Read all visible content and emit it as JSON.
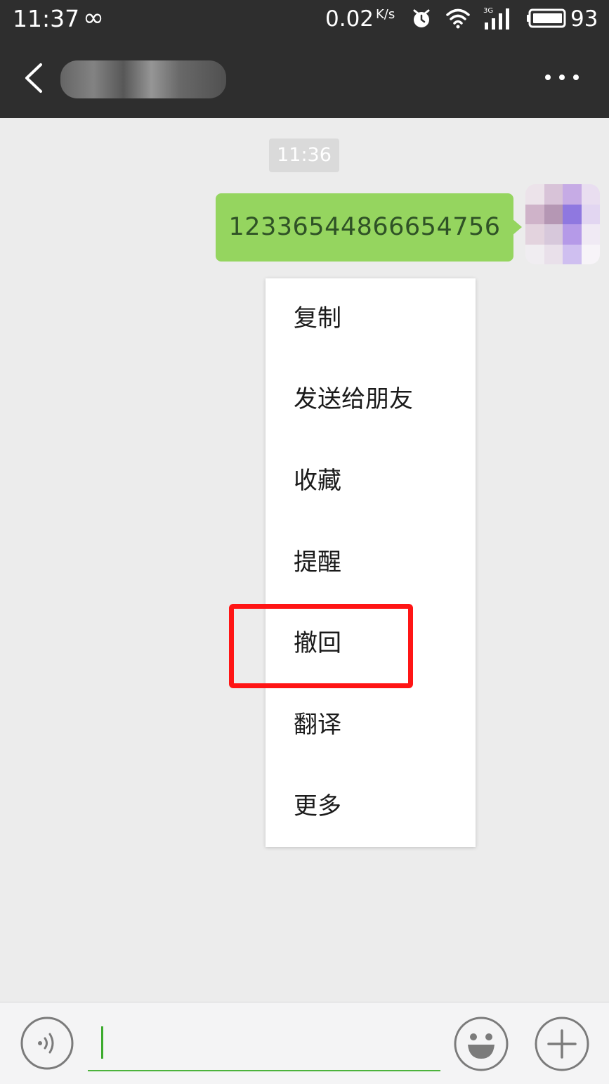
{
  "status_bar": {
    "time": "11:37",
    "infinity_symbol": "∞",
    "speed": "0.02",
    "speed_unit": "K/s",
    "battery": "93",
    "icons": [
      "alarm-icon",
      "wifi-icon",
      "signal-icon",
      "battery-icon"
    ],
    "network_label": "3G"
  },
  "title_bar": {
    "contact_name_obscured": true,
    "back_icon": "chevron-left-icon",
    "more_icon": "more-dots-icon"
  },
  "chat": {
    "timestamp": "11:36",
    "messages": [
      {
        "text": "12336544866654756",
        "sender": "self"
      }
    ]
  },
  "context_menu": {
    "items": [
      {
        "label": "复制"
      },
      {
        "label": "发送给朋友"
      },
      {
        "label": "收藏"
      },
      {
        "label": "提醒"
      },
      {
        "label": "撤回"
      },
      {
        "label": "翻译"
      },
      {
        "label": "更多"
      }
    ],
    "highlighted_item": "撤回"
  },
  "input_bar": {
    "value": "",
    "icons": [
      "voice-icon",
      "emoji-icon",
      "plus-icon"
    ]
  },
  "colors": {
    "header_background": "#2e2e2e",
    "chat_background": "#ececec",
    "bubble_green": "#95d55f",
    "highlight_red": "#ff1515",
    "input_underline": "#4cb33c"
  }
}
